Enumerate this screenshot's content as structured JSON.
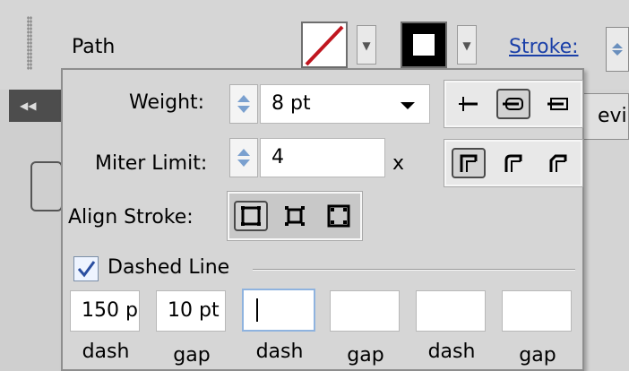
{
  "control_bar": {
    "object_type": "Path",
    "stroke_link": "Stroke:"
  },
  "stroke_panel": {
    "weight": {
      "label": "Weight:",
      "value": "8 pt"
    },
    "miter_limit": {
      "label": "Miter Limit:",
      "value": "4",
      "unit": "x"
    },
    "align_stroke": {
      "label": "Align Stroke:"
    },
    "dashed_line": {
      "label": "Dashed Line",
      "checked": true
    },
    "dash_gap": [
      {
        "label": "dash",
        "value": "150 p"
      },
      {
        "label": "gap",
        "value": "10 pt"
      },
      {
        "label": "dash",
        "value": ""
      },
      {
        "label": "gap",
        "value": ""
      },
      {
        "label": "dash",
        "value": ""
      },
      {
        "label": "gap",
        "value": ""
      }
    ]
  },
  "background": {
    "right_button_text": "evi",
    "left_tab_icon": "collapse-left-icon"
  },
  "colors": {
    "accent_link": "#1a3fa8",
    "fill_slash": "#c0161f",
    "focus_border": "#8fb3df"
  }
}
